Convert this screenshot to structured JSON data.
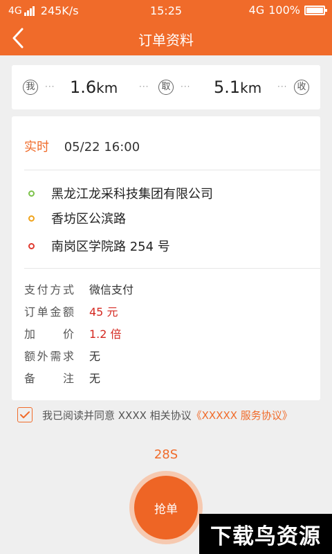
{
  "status": {
    "network": "4G",
    "speed": "245K/s",
    "time": "15:25",
    "network_right": "4G",
    "battery": "100%"
  },
  "nav": {
    "title": "订单资料"
  },
  "distance": {
    "me_label": "我",
    "pickup_label": "取",
    "receive_label": "收",
    "dist1_value": "1.6",
    "dist1_unit": "km",
    "dist2_value": "5.1",
    "dist2_unit": "km",
    "dots": "···"
  },
  "order": {
    "time_type": "实时",
    "time": "05/22  16:00",
    "addresses": [
      {
        "text": "黑龙江龙采科技集团有限公司",
        "color": "#7cc24a"
      },
      {
        "text": "香坊区公滨路",
        "color": "#f0a31a"
      },
      {
        "text": "南岗区学院路 254 号",
        "color": "#e0392e"
      }
    ],
    "info": [
      {
        "label": "支付方式",
        "value": "微信支付",
        "highlight": false
      },
      {
        "label": "订单金额",
        "value": "45 元",
        "highlight": true
      },
      {
        "label": "加价",
        "value": "1.2 倍",
        "highlight": true
      },
      {
        "label": "额外需求",
        "value": "无",
        "highlight": false
      },
      {
        "label": "备注",
        "value": "无",
        "highlight": false
      }
    ]
  },
  "agreement": {
    "text": "我已阅读并同意 XXXX 相关协议",
    "link": "《XXXXX 服务协议》",
    "checked": true
  },
  "countdown": "28S",
  "grab_button": "抢单",
  "watermark": "下载鸟资源",
  "colors": {
    "accent": "#f06b2a",
    "price": "#d4271f"
  }
}
